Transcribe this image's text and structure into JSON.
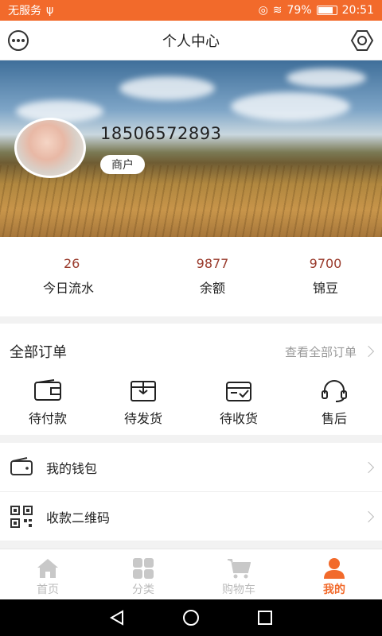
{
  "status_bar": {
    "carrier": "无服务",
    "battery_percent": "79%",
    "time": "20:51",
    "colors": {
      "background": "#f26a2b"
    }
  },
  "header": {
    "title": "个人中心",
    "left_icon": "message-icon",
    "right_icon": "settings-icon"
  },
  "profile": {
    "phone": "18506572893",
    "role": "商户"
  },
  "stats": [
    {
      "value": "26",
      "label": "今日流水"
    },
    {
      "value": "9877",
      "label": "余额"
    },
    {
      "value": "9700",
      "label": "锦豆"
    }
  ],
  "orders": {
    "title": "全部订单",
    "view_all": "查看全部订单",
    "items": [
      {
        "label": "待付款",
        "icon": "wallet-icon"
      },
      {
        "label": "待发货",
        "icon": "box-icon"
      },
      {
        "label": "待收货",
        "icon": "inbox-check-icon"
      },
      {
        "label": "售后",
        "icon": "headset-icon"
      }
    ]
  },
  "menu": [
    {
      "label": "我的钱包",
      "icon": "wallet-icon"
    },
    {
      "label": "收款二维码",
      "icon": "qrcode-icon"
    }
  ],
  "tabbar": [
    {
      "label": "首页",
      "icon": "home-icon",
      "active": false
    },
    {
      "label": "分类",
      "icon": "grid-icon",
      "active": false
    },
    {
      "label": "购物车",
      "icon": "cart-icon",
      "active": false
    },
    {
      "label": "我的",
      "icon": "user-icon",
      "active": true
    }
  ],
  "colors": {
    "accent": "#f26a2b",
    "stat_value": "#9a3b2c"
  }
}
